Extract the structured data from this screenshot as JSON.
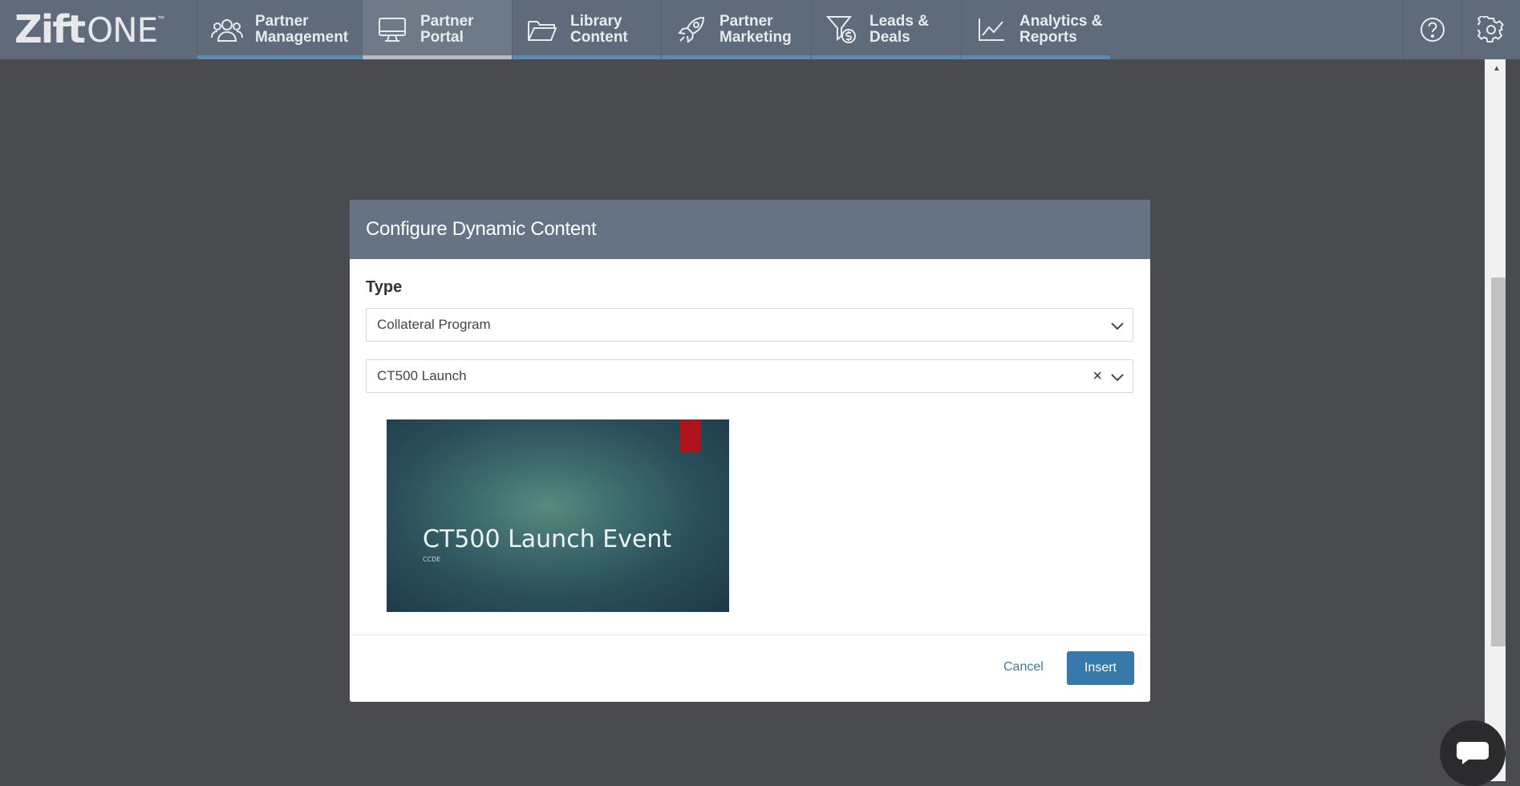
{
  "logo": {
    "bold": "Zift",
    "light": "ONE",
    "tm": "™"
  },
  "nav": {
    "items": [
      {
        "line1": "Partner",
        "line2": "Management",
        "icon": "users-icon"
      },
      {
        "line1": "Partner",
        "line2": "Portal",
        "icon": "monitor-icon",
        "active": true
      },
      {
        "line1": "Library",
        "line2": "Content",
        "icon": "folder-icon"
      },
      {
        "line1": "Partner",
        "line2": "Marketing",
        "icon": "rocket-icon"
      },
      {
        "line1": "Leads &",
        "line2": "Deals",
        "icon": "funnel-dollar-icon"
      },
      {
        "line1": "Analytics &",
        "line2": "Reports",
        "icon": "line-chart-icon"
      }
    ],
    "right_icons": [
      "help-icon",
      "gear-icon"
    ]
  },
  "modal": {
    "title": "Configure Dynamic Content",
    "type_label": "Type",
    "type_value": "Collateral Program",
    "program_value": "CT500 Launch",
    "clear_symbol": "×",
    "thumbnail": {
      "title": "CT500 Launch Event",
      "subtitle": "CCDE"
    },
    "cancel_label": "Cancel",
    "insert_label": "Insert"
  },
  "colors": {
    "nav_bg": "#5f6b7b",
    "nav_accent": "#4f8fba",
    "modal_header": "#667384",
    "primary_button": "#3779aa",
    "overlay": "#4a4b4f",
    "thumbnail_ribbon": "#b0121b"
  }
}
